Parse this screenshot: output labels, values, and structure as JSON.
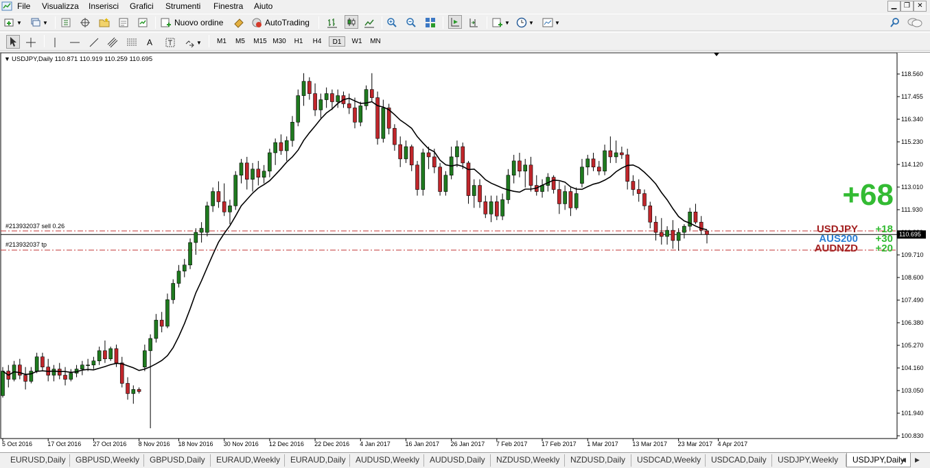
{
  "menubar": {
    "items": [
      "File",
      "Visualizza",
      "Inserisci",
      "Grafici",
      "Strumenti",
      "Finestra",
      "Aiuto"
    ]
  },
  "toolbar1": {
    "new_order_label": "Nuovo ordine",
    "autotrading_label": "AutoTrading"
  },
  "toolbar2": {
    "timeframes": [
      "M1",
      "M5",
      "M15",
      "M30",
      "H1",
      "H4",
      "D1",
      "W1",
      "MN"
    ],
    "active_timeframe": "D1"
  },
  "chart": {
    "header": "USDJPY,Daily  110.871 110.919 110.259 110.695",
    "order_line_label": "#213932037 sell 0.26",
    "tp_line_label": "#213932037 tp",
    "current_price": "110.695",
    "big_profit": "+68",
    "symbol_profits": [
      {
        "symbol": "USDJPY",
        "value": "+18",
        "color": "#a32020"
      },
      {
        "symbol": "AUS200",
        "value": "+30",
        "color": "#2b7fd6"
      },
      {
        "symbol": "AUDNZD",
        "value": "+20",
        "color": "#a32020"
      }
    ],
    "profit_color": "#33bb33"
  },
  "chart_data": {
    "type": "candlestick",
    "symbol": "USDJPY",
    "timeframe": "Daily",
    "price_axis_ticks": [
      "118.560",
      "117.455",
      "116.340",
      "115.230",
      "114.120",
      "113.010",
      "111.930",
      "110.820",
      "109.710",
      "108.600",
      "107.490",
      "106.380",
      "105.270",
      "104.160",
      "103.050",
      "101.940",
      "100.830"
    ],
    "date_axis_ticks": [
      "5 Oct 2016",
      "17 Oct 2016",
      "27 Oct 2016",
      "8 Nov 2016",
      "18 Nov 2016",
      "30 Nov 2016",
      "12 Dec 2016",
      "22 Dec 2016",
      "4 Jan 2017",
      "16 Jan 2017",
      "26 Jan 2017",
      "7 Feb 2017",
      "17 Feb 2017",
      "1 Mar 2017",
      "13 Mar 2017",
      "23 Mar 2017",
      "4 Apr 2017"
    ],
    "ylim": [
      100.83,
      118.56
    ],
    "order_price": 110.871,
    "tp_price": 109.93,
    "close_price": 110.695,
    "bull_color": "#1f7a1f",
    "bear_color": "#c0262b",
    "ma_color": "#000000",
    "candles": [
      [
        102.8,
        104.2,
        102.7,
        104.0
      ],
      [
        104.0,
        104.3,
        103.2,
        103.6
      ],
      [
        103.6,
        104.5,
        103.5,
        104.3
      ],
      [
        104.3,
        104.6,
        103.6,
        103.8
      ],
      [
        103.8,
        104.2,
        103.1,
        103.5
      ],
      [
        103.5,
        104.2,
        103.4,
        104.0
      ],
      [
        104.0,
        104.9,
        103.9,
        104.7
      ],
      [
        104.7,
        104.9,
        104.0,
        104.2
      ],
      [
        104.2,
        104.6,
        103.5,
        103.8
      ],
      [
        103.8,
        104.3,
        103.5,
        104.1
      ],
      [
        104.1,
        104.4,
        103.6,
        103.8
      ],
      [
        103.8,
        104.2,
        103.3,
        103.6
      ],
      [
        103.6,
        104.1,
        103.5,
        103.9
      ],
      [
        103.9,
        104.3,
        103.7,
        104.1
      ],
      [
        104.1,
        104.5,
        103.8,
        104.3
      ],
      [
        104.3,
        104.6,
        104.0,
        104.3
      ],
      [
        104.3,
        104.7,
        104.1,
        104.5
      ],
      [
        104.5,
        105.2,
        104.3,
        105.0
      ],
      [
        105.0,
        105.5,
        104.4,
        104.6
      ],
      [
        104.6,
        105.2,
        104.5,
        105.1
      ],
      [
        105.1,
        105.3,
        104.2,
        104.4
      ],
      [
        104.4,
        104.7,
        103.2,
        103.4
      ],
      [
        103.4,
        103.7,
        102.6,
        102.9
      ],
      [
        102.9,
        103.3,
        102.4,
        103.1
      ],
      [
        103.1,
        103.2,
        102.9,
        103.0
      ],
      [
        104.2,
        105.3,
        104.0,
        105.0
      ],
      [
        105.0,
        105.8,
        101.2,
        105.6
      ],
      [
        105.6,
        106.8,
        105.4,
        106.5
      ],
      [
        106.5,
        106.9,
        105.9,
        106.2
      ],
      [
        106.2,
        107.8,
        106.1,
        107.5
      ],
      [
        107.5,
        108.5,
        107.3,
        108.3
      ],
      [
        108.3,
        109.2,
        108.1,
        108.9
      ],
      [
        108.9,
        109.5,
        108.6,
        109.2
      ],
      [
        109.2,
        110.5,
        109.0,
        110.3
      ],
      [
        110.3,
        111.0,
        109.7,
        110.8
      ],
      [
        110.8,
        111.3,
        110.3,
        111.0
      ],
      [
        110.8,
        112.3,
        110.6,
        112.1
      ],
      [
        112.1,
        113.0,
        111.8,
        112.8
      ],
      [
        112.8,
        113.3,
        112.0,
        112.3
      ],
      [
        112.3,
        113.2,
        111.6,
        111.8
      ],
      [
        111.8,
        112.4,
        111.2,
        112.1
      ],
      [
        112.1,
        113.8,
        111.9,
        113.6
      ],
      [
        113.6,
        114.4,
        113.2,
        114.2
      ],
      [
        114.2,
        114.5,
        112.9,
        113.4
      ],
      [
        113.4,
        114.2,
        112.8,
        113.9
      ],
      [
        113.9,
        114.3,
        113.1,
        113.5
      ],
      [
        113.5,
        114.1,
        113.2,
        113.8
      ],
      [
        113.8,
        114.9,
        113.5,
        114.7
      ],
      [
        114.7,
        115.4,
        114.1,
        115.2
      ],
      [
        115.2,
        115.6,
        114.6,
        114.8
      ],
      [
        114.8,
        115.5,
        114.3,
        115.3
      ],
      [
        115.3,
        116.5,
        115.0,
        116.2
      ],
      [
        116.2,
        117.8,
        116.0,
        117.5
      ],
      [
        117.5,
        118.6,
        117.0,
        118.2
      ],
      [
        118.2,
        118.4,
        117.3,
        117.6
      ],
      [
        117.6,
        118.1,
        116.5,
        116.8
      ],
      [
        116.8,
        117.6,
        116.4,
        117.3
      ],
      [
        117.3,
        117.9,
        116.9,
        117.6
      ],
      [
        117.6,
        117.8,
        116.8,
        117.2
      ],
      [
        117.2,
        117.8,
        116.9,
        117.5
      ],
      [
        117.5,
        117.7,
        116.9,
        117.1
      ],
      [
        117.1,
        117.6,
        116.6,
        116.9
      ],
      [
        116.9,
        117.4,
        115.9,
        116.2
      ],
      [
        116.2,
        117.2,
        116.0,
        117.0
      ],
      [
        117.0,
        118.0,
        116.8,
        117.8
      ],
      [
        117.8,
        118.6,
        117.2,
        117.4
      ],
      [
        117.4,
        117.7,
        115.1,
        115.4
      ],
      [
        115.4,
        117.3,
        115.2,
        116.9
      ],
      [
        116.9,
        117.1,
        115.6,
        115.9
      ],
      [
        115.9,
        116.1,
        114.8,
        115.1
      ],
      [
        115.1,
        115.5,
        114.0,
        114.4
      ],
      [
        114.4,
        115.3,
        114.2,
        115.0
      ],
      [
        115.0,
        115.1,
        113.8,
        114.1
      ],
      [
        114.1,
        114.3,
        112.6,
        112.9
      ],
      [
        112.9,
        114.9,
        112.6,
        114.7
      ],
      [
        114.7,
        115.0,
        113.9,
        114.5
      ],
      [
        114.5,
        114.9,
        113.7,
        114.0
      ],
      [
        114.0,
        114.2,
        112.6,
        112.8
      ],
      [
        112.8,
        113.8,
        112.6,
        113.6
      ],
      [
        113.6,
        115.0,
        113.4,
        114.5
      ],
      [
        114.5,
        115.3,
        114.0,
        115.0
      ],
      [
        115.0,
        115.2,
        113.9,
        114.2
      ],
      [
        114.2,
        114.3,
        112.2,
        112.6
      ],
      [
        112.6,
        113.4,
        112.0,
        113.1
      ],
      [
        113.1,
        113.4,
        112.0,
        112.3
      ],
      [
        112.3,
        112.6,
        111.5,
        111.7
      ],
      [
        111.7,
        112.6,
        111.3,
        112.3
      ],
      [
        112.3,
        112.6,
        111.4,
        111.6
      ],
      [
        111.6,
        112.7,
        111.4,
        112.4
      ],
      [
        112.4,
        113.9,
        112.2,
        113.6
      ],
      [
        113.6,
        114.6,
        113.2,
        114.3
      ],
      [
        114.3,
        114.7,
        113.5,
        113.8
      ],
      [
        113.8,
        114.4,
        113.0,
        114.1
      ],
      [
        114.1,
        114.5,
        112.8,
        113.1
      ],
      [
        113.1,
        113.6,
        112.6,
        112.8
      ],
      [
        112.8,
        113.4,
        112.5,
        113.1
      ],
      [
        113.1,
        113.7,
        112.8,
        113.5
      ],
      [
        113.5,
        113.6,
        112.7,
        112.9
      ],
      [
        112.9,
        113.3,
        111.7,
        112.2
      ],
      [
        112.2,
        113.1,
        111.9,
        112.8
      ],
      [
        112.8,
        113.0,
        111.6,
        112.0
      ],
      [
        112.0,
        113.0,
        111.9,
        112.7
      ],
      [
        113.2,
        114.4,
        113.0,
        114.0
      ],
      [
        114.0,
        114.6,
        113.6,
        114.4
      ],
      [
        114.4,
        114.7,
        113.8,
        114.0
      ],
      [
        114.0,
        114.3,
        113.6,
        113.8
      ],
      [
        113.8,
        115.1,
        113.6,
        114.8
      ],
      [
        114.8,
        115.5,
        114.2,
        114.5
      ],
      [
        114.5,
        115.3,
        114.2,
        114.7
      ],
      [
        114.7,
        115.0,
        114.4,
        114.6
      ],
      [
        114.6,
        114.9,
        112.9,
        113.3
      ],
      [
        113.3,
        113.6,
        112.6,
        112.9
      ],
      [
        112.9,
        113.4,
        112.3,
        112.7
      ],
      [
        112.7,
        112.9,
        111.9,
        112.1
      ],
      [
        112.1,
        112.3,
        111.0,
        111.3
      ],
      [
        111.3,
        111.6,
        110.4,
        110.8
      ],
      [
        110.8,
        111.5,
        110.2,
        110.6
      ],
      [
        110.6,
        111.1,
        110.2,
        110.9
      ],
      [
        110.9,
        111.4,
        110.0,
        110.4
      ],
      [
        110.4,
        111.0,
        109.9,
        110.8
      ],
      [
        110.8,
        111.2,
        110.5,
        111.1
      ],
      [
        111.1,
        112.0,
        110.9,
        111.8
      ],
      [
        111.8,
        112.2,
        111.2,
        111.3
      ],
      [
        111.3,
        111.6,
        110.7,
        110.9
      ],
      [
        110.871,
        110.919,
        110.259,
        110.695
      ]
    ]
  }
}
